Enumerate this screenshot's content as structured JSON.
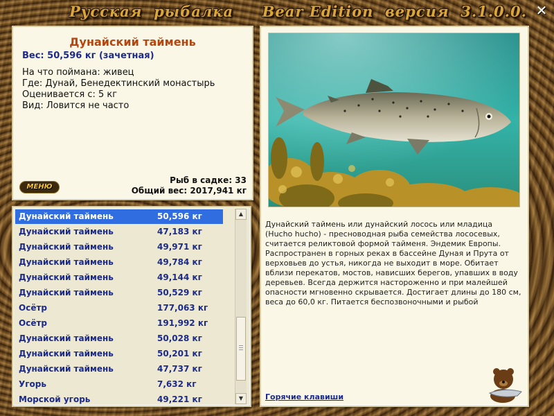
{
  "app": {
    "title": "Русская  рыбалка     Bear Edition  версия  3.1.0.0.",
    "close_symbol": "✕"
  },
  "info": {
    "fish_name": "Дунайский таймень",
    "weight": "Вес: 50,596 кг (зачетная)",
    "details": [
      "На что поймана: живец",
      "Где: Дунай, Бенедектинский монастырь",
      "Оценивается с: 5 кг",
      "Вид: Ловится не часто"
    ],
    "menu_label": "МЕНЮ",
    "fish_in_keepnet": "Рыб в садке: 33",
    "total_weight": "Общий вес: 2017,941 кг"
  },
  "catch_list": {
    "selected_index": 0,
    "rows": [
      {
        "name": "Дунайский таймень",
        "weight": "50,596 кг"
      },
      {
        "name": "Дунайский таймень",
        "weight": "47,183 кг"
      },
      {
        "name": "Дунайский таймень",
        "weight": "49,971 кг"
      },
      {
        "name": "Дунайский таймень",
        "weight": "49,784 кг"
      },
      {
        "name": "Дунайский таймень",
        "weight": "49,144 кг"
      },
      {
        "name": "Дунайский таймень",
        "weight": "50,529 кг"
      },
      {
        "name": "Осётр",
        "weight": "177,063 кг"
      },
      {
        "name": "Осётр",
        "weight": "191,992 кг"
      },
      {
        "name": "Дунайский таймень",
        "weight": "50,028 кг"
      },
      {
        "name": "Дунайский таймень",
        "weight": "50,201 кг"
      },
      {
        "name": "Дунайский таймень",
        "weight": "47,737 кг"
      },
      {
        "name": "Угорь",
        "weight": "7,632 кг"
      },
      {
        "name": "Морской угорь",
        "weight": "49,221 кг"
      }
    ]
  },
  "description": {
    "text": "Дунайский таймень или дунайский лосось или младица (Hucho hucho) - пресноводная рыба семейства лососевых, считается реликтовой формой тайменя. Эндемик Европы. Распространен в горных реках в бассейне Дуная и Прута от верховьев до устья, никогда не выходит в море. Обитает вблизи перекатов, мостов, нависших берегов, упавших в воду деревьев. Всегда держится настороженно и при малейшей опасности мгновенно скрывается. Достигает длины до 180 см, веса до 60,0 кг. Питается беспозвоночными и рыбой",
    "hotkeys_link": "Горячие клавиши"
  },
  "colors": {
    "title": "#d9a63b",
    "fish_name": "#b4470f",
    "list_text": "#1c2b8a",
    "selection": "#2f6de0",
    "panel_bg": "#fbf7e6"
  }
}
